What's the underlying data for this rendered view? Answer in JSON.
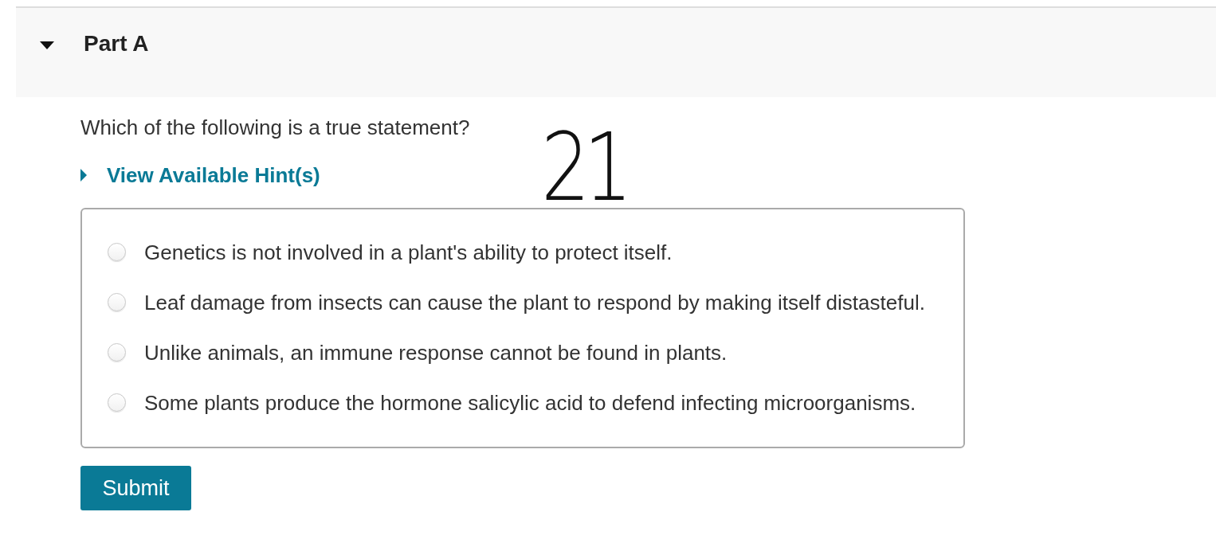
{
  "part": {
    "title": "Part A",
    "expanded": true
  },
  "question": {
    "prompt": "Which of the following is a true statement?",
    "hint": {
      "label": "View Available Hint(s)",
      "expanded": false
    },
    "options": [
      {
        "label": "Genetics is not involved in a plant's ability to protect itself.",
        "selected": false
      },
      {
        "label": "Leaf damage from insects can cause the plant to respond by making itself distasteful.",
        "selected": false
      },
      {
        "label": "Unlike animals, an immune response cannot be found in plants.",
        "selected": false
      },
      {
        "label": "Some plants produce the hormone salicylic acid to defend infecting microorganisms.",
        "selected": false
      }
    ]
  },
  "submit": "Submit",
  "handwritten_note": "21"
}
